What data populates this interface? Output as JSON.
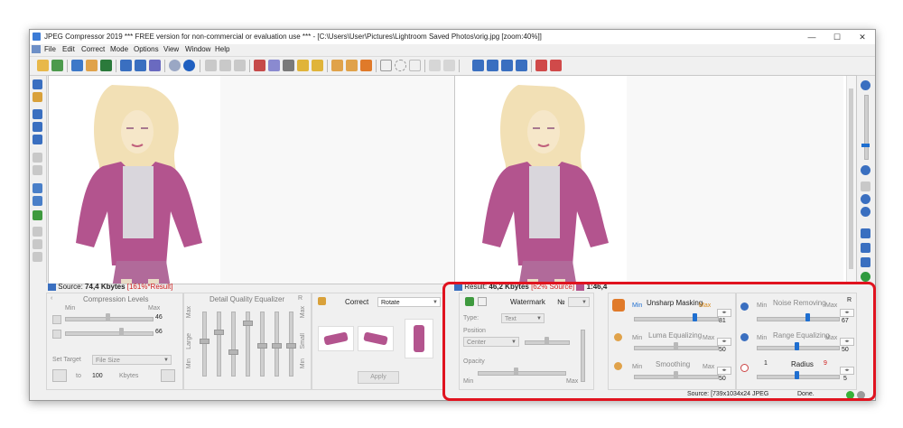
{
  "window": {
    "title": "JPEG Compressor 2019    *** FREE version for non-commercial or evaluation use ***  - [C:\\Users\\User\\Pictures\\Lightroom Saved Photos\\orig.jpg  [zoom:40%]]",
    "controls": {
      "minimize": "—",
      "maximize": "☐",
      "close": "✕"
    }
  },
  "menu": [
    "File",
    "Edit",
    "Correct",
    "Mode",
    "Options",
    "View",
    "Window",
    "Help"
  ],
  "status": {
    "source_label": "Source:",
    "source_size": "74,4 Kbytes",
    "source_ratio": "[161%*Result]",
    "result_label": "Result:",
    "result_size": "46,2 Kbytes",
    "result_ratio": "[62% Source]",
    "result_extra": "1:46,4",
    "final_source": "Source: [739x1034x24 JPEG",
    "final_done": "Done."
  },
  "compression": {
    "title": "Compression Levels",
    "min": "Min",
    "max": "Max",
    "value1": "46",
    "value2": "66",
    "set_target": "Set Target",
    "target_type": "File Size",
    "to": "to",
    "target_value": "100",
    "units": "Kbytes"
  },
  "equalizer": {
    "title": "Detail Quality Equalizer",
    "r": "R",
    "max": "Max",
    "min": "Min",
    "large": "Large",
    "small": "Small"
  },
  "correct": {
    "label": "Correct",
    "option": "Rotate",
    "apply": "Apply"
  },
  "watermark": {
    "title": "Watermark",
    "no": "№",
    "type_label": "Type:",
    "type_value": "Text",
    "position_label": "Position",
    "position_value": "Center",
    "opacity_label": "Opacity",
    "min": "Min",
    "max": "Max"
  },
  "filters": {
    "r": "R",
    "unsharp": {
      "label": "Unsharp Masking",
      "min": "Min",
      "max": "Max",
      "value": "81"
    },
    "luma": {
      "label": "Luma Equalizing",
      "min": "Min",
      "max": "Max",
      "value": "50"
    },
    "smoothing": {
      "label": "Smoothing",
      "min": "Min",
      "max": "Max",
      "value": "50"
    },
    "noise": {
      "label": "Noise Removing",
      "min": "Min",
      "max": "Max",
      "value": "67"
    },
    "range": {
      "label": "Range Equalizing",
      "min": "Min",
      "max": "Max",
      "value": "50"
    },
    "radius": {
      "label": "Radius",
      "min": "1",
      "max": "9",
      "value": "5"
    }
  },
  "colors": {
    "accent": "#1f6fd0",
    "highlight_box": "#e0131f",
    "jacket": "#b3548e",
    "hair": "#f2e0b5"
  }
}
